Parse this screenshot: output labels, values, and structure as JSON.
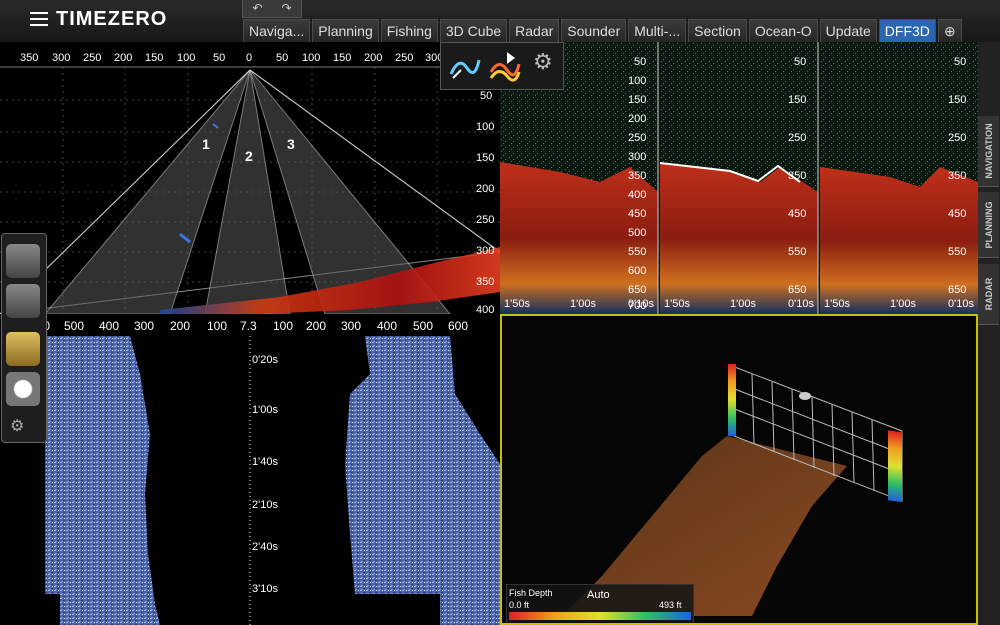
{
  "app": {
    "title": "TIMEZERO"
  },
  "undo": {
    "undo_icon": "undo-icon",
    "redo_icon": "redo-icon"
  },
  "tabs": [
    "Naviga...",
    "Planning",
    "Fishing",
    "3D Cube",
    "Radar",
    "Sounder",
    "Multi-...",
    "Section",
    "Ocean-O",
    "Update",
    "DFF3D"
  ],
  "active_tab": "DFF3D",
  "side_tabs": [
    "NAVIGATION",
    "PLANNING",
    "RADAR"
  ],
  "triple_beam": {
    "top_scale": [
      "350",
      "300",
      "250",
      "200",
      "150",
      "100",
      "50",
      "0",
      "50",
      "100",
      "150",
      "200",
      "250",
      "300"
    ],
    "depth_scale": [
      "50",
      "100",
      "150",
      "200",
      "250",
      "300",
      "350",
      "400"
    ],
    "beam_labels": [
      "1",
      "2",
      "3"
    ]
  },
  "side_scan": {
    "range_scale": [
      "600",
      "500",
      "400",
      "300",
      "200",
      "100",
      "7.3",
      "100",
      "200",
      "300",
      "400",
      "500",
      "600"
    ],
    "time_scale": [
      "0'20s",
      "1'00s",
      "1'40s",
      "2'10s",
      "2'40s",
      "3'10s"
    ]
  },
  "echo": {
    "depth_scale": [
      "50",
      "100",
      "150",
      "200",
      "250",
      "300",
      "350",
      "400",
      "450",
      "500",
      "550",
      "600",
      "650",
      "700"
    ],
    "time_labels": [
      "1'50s",
      "1'00s",
      "0'10s"
    ]
  },
  "view3d": {
    "legend_title": "Fish Depth",
    "legend_mode": "Auto",
    "legend_min": "0.0 ft",
    "legend_max": "493 ft"
  },
  "tools": [
    "transducer-icon",
    "sounder-icon",
    "hand-icon",
    "target-icon",
    "settings-lock-icon"
  ],
  "colors": {
    "accent": "#2b67b0",
    "highlight_border": "#c8c000"
  }
}
